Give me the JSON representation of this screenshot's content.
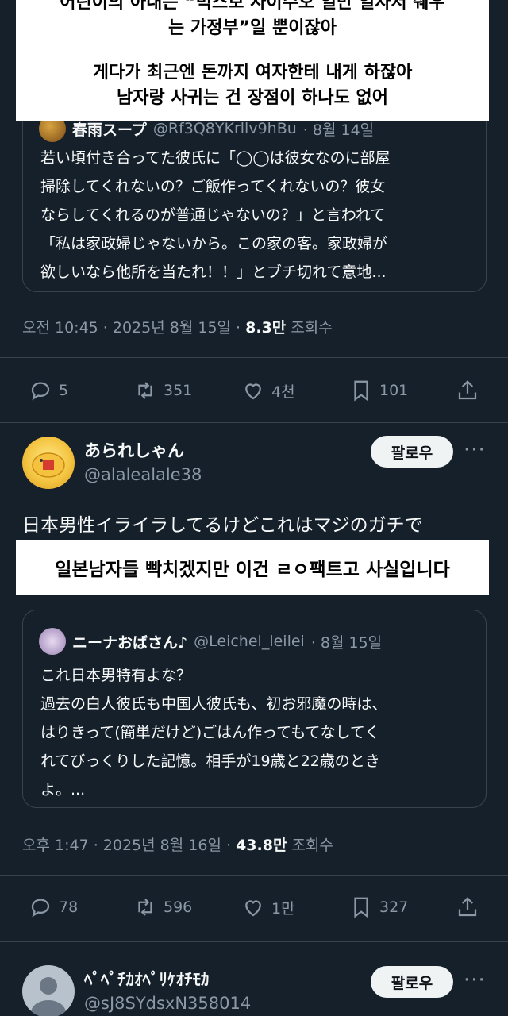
{
  "caption_top": {
    "line1": "어린이의 아내는 “빅스보 사이수오 일만 일자서 쉐우",
    "line2": "는 가정부”일 뿐이잖아",
    "line3": "게다가 최근엔 돈까지 여자한테 내게 하잖아",
    "line4": "남자랑 사귀는 건 장점이 하나도 없어"
  },
  "quote1": {
    "name": "春雨スープ",
    "handle": "@Rf3Q8YKrllv9hBu",
    "date": "· 8월 14일",
    "lines": [
      "若い頃付き合ってた彼氏に「◯◯は彼女なのに部屋",
      "掃除してくれないの？ご飯作ってくれないの？彼女",
      "ならしてくれるのが普通じゃないの？」と言われて",
      "「私は家政婦じゃないから。この家の客。家政婦が",
      "欲しいなら他所を当たれ！！」とブチ切れて意地..."
    ]
  },
  "tweet1_meta": {
    "time": "오전 10:45 · 2025년 8월 15일 ·",
    "views": "8.3만",
    "views_label": "조회수"
  },
  "tweet1_actions": {
    "replies": "5",
    "reposts": "351",
    "likes": "4천",
    "bookmarks": "101"
  },
  "tweet2": {
    "name": "あられしゃん",
    "handle": "@alalealale38",
    "follow": "팔로우",
    "more": "···",
    "text": "日本男性イライラしてるけどこれはマジのガチで"
  },
  "caption_mid": "일본남자들 빡치겠지만 이건 ㄹㅇ팩트고 사실입니다",
  "quote2": {
    "name": "ニーナおばさん♪",
    "handle": "@Leichel_leilei",
    "date": "· 8월 15일",
    "lines": [
      "これ日本男特有よな？",
      "過去の白人彼氏も中国人彼氏も、初お邪魔の時は、",
      "はりきって(簡単だけど)ごはん作ってもてなしてく",
      "れてびっくりした記憶。相手が19歳と22歳のとき",
      "よ。..."
    ]
  },
  "tweet2_meta": {
    "time": "오후 1:47 · 2025년 8월 16일 ·",
    "views": "43.8만",
    "views_label": "조회수"
  },
  "tweet2_actions": {
    "replies": "78",
    "reposts": "596",
    "likes": "1만",
    "bookmarks": "327"
  },
  "tweet3": {
    "name": "ﾍﾟﾍﾟﾁｶｵﾍﾟﾘｹｵﾁﾓｶ",
    "handle": "@sJ8SYdsxN358014",
    "follow": "팔로우",
    "more": "···"
  }
}
